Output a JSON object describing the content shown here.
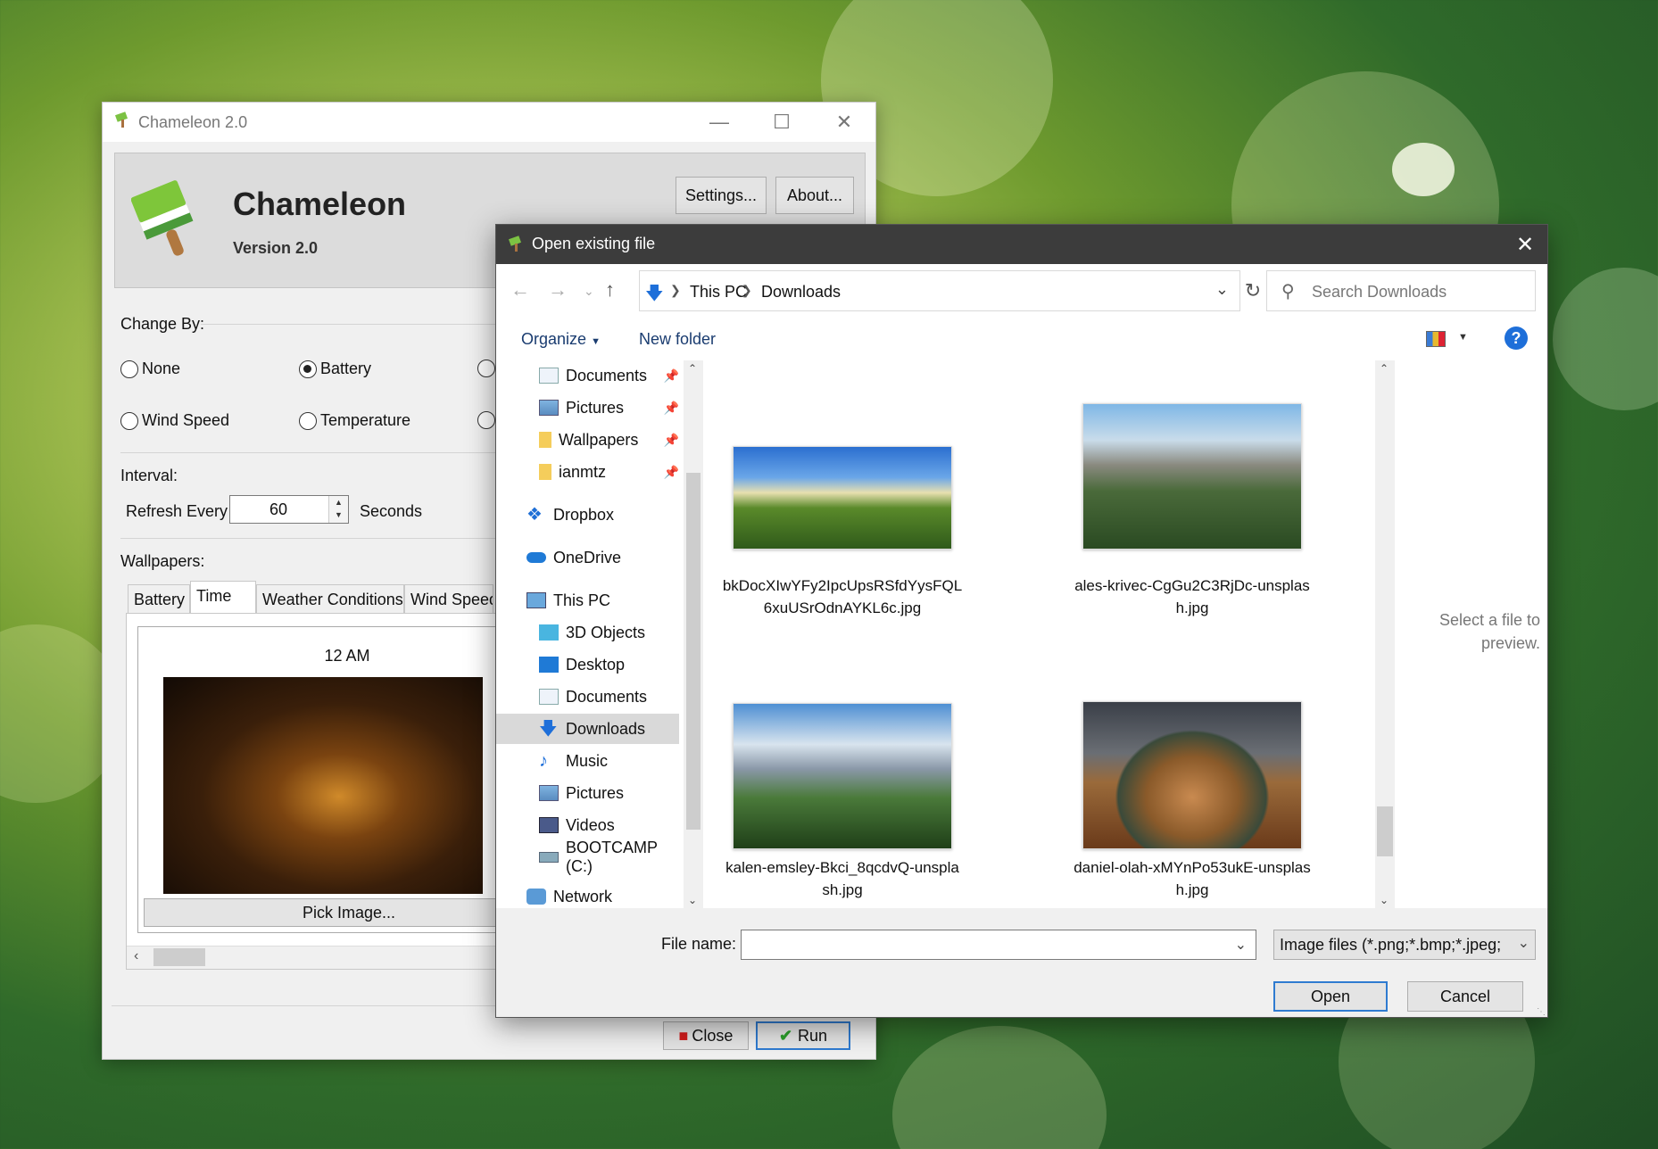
{
  "chameleon": {
    "window_title": "Chameleon 2.0",
    "app_name": "Chameleon",
    "version": "Version 2.0",
    "settings_button": "Settings...",
    "about_button": "About...",
    "change_by_label": "Change By:",
    "radios": [
      {
        "label": "None",
        "selected": false
      },
      {
        "label": "Battery",
        "selected": true
      },
      {
        "label": "Wind Speed",
        "selected": false
      },
      {
        "label": "Temperature",
        "selected": false
      }
    ],
    "interval_label": "Interval:",
    "refresh_label": "Refresh Every",
    "refresh_value": "60",
    "seconds_label": "Seconds",
    "wallpapers_label": "Wallpapers:",
    "tabs": [
      "Battery",
      "Time",
      "Weather Conditions",
      "Wind Speed"
    ],
    "active_tab": "Time",
    "wallpaper_time": "12 AM",
    "pick_image_button": "Pick Image...",
    "close_button": "Close",
    "run_button": "Run"
  },
  "dialog": {
    "title": "Open existing file",
    "breadcrumb": [
      "This PC",
      "Downloads"
    ],
    "search_placeholder": "Search Downloads",
    "organize": "Organize",
    "new_folder": "New folder",
    "nav_items": [
      {
        "label": "Documents",
        "icon": "documents-icon",
        "pinned": true
      },
      {
        "label": "Pictures",
        "icon": "pictures-icon",
        "pinned": true
      },
      {
        "label": "Wallpapers",
        "icon": "folder-icon",
        "pinned": true
      },
      {
        "label": "ianmtz",
        "icon": "folder-icon",
        "pinned": true
      },
      {
        "label": "Dropbox",
        "icon": "dropbox-icon",
        "pinned": false
      },
      {
        "label": "OneDrive",
        "icon": "onedrive-icon",
        "pinned": false
      },
      {
        "label": "This PC",
        "icon": "computer-icon",
        "pinned": false
      },
      {
        "label": "3D Objects",
        "icon": "3d-objects-icon",
        "pinned": false
      },
      {
        "label": "Desktop",
        "icon": "desktop-icon",
        "pinned": false
      },
      {
        "label": "Documents",
        "icon": "documents-icon",
        "pinned": false
      },
      {
        "label": "Downloads",
        "icon": "downloads-icon",
        "pinned": false,
        "selected": true
      },
      {
        "label": "Music",
        "icon": "music-icon",
        "pinned": false
      },
      {
        "label": "Pictures",
        "icon": "pictures-icon",
        "pinned": false
      },
      {
        "label": "Videos",
        "icon": "videos-icon",
        "pinned": false
      },
      {
        "label": "BOOTCAMP (C:)",
        "icon": "drive-icon",
        "pinned": false
      },
      {
        "label": "Network",
        "icon": "network-icon",
        "pinned": false
      }
    ],
    "files": [
      {
        "name": "bkDocXIwYFy2IpcUpsRSfdYysFQL6xuUSrOdnAYKL6c.jpg"
      },
      {
        "name": "ales-krivec-CgGu2C3RjDc-unsplash.jpg"
      },
      {
        "name": "kalen-emsley-Bkci_8qcdvQ-unsplash.jpg"
      },
      {
        "name": "daniel-olah-xMYnPo53ukE-unsplash.jpg"
      }
    ],
    "preview_text": "Select a file to preview.",
    "file_name_label": "File name:",
    "file_name_value": "",
    "file_type": "Image files (*.png;*.bmp;*.jpeg;",
    "open_button": "Open",
    "cancel_button": "Cancel"
  }
}
